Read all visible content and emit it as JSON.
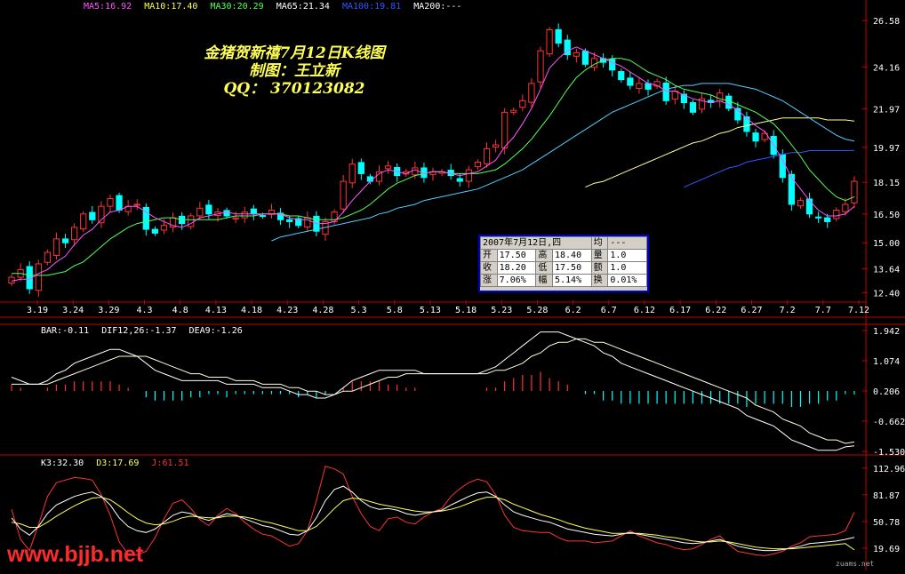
{
  "title_lines": [
    "金猪贺新禧7月12日K线图",
    "制图：王立新",
    "QQ： 370123082"
  ],
  "ma_legend": [
    {
      "label": "MA5:16.92",
      "color": "#ff55ff"
    },
    {
      "label": "MA10:17.40",
      "color": "#ffff55"
    },
    {
      "label": "MA30:20.29",
      "color": "#55ff55"
    },
    {
      "label": "MA65:21.34",
      "color": "#ffffff"
    },
    {
      "label": "MA100:19.81",
      "color": "#3355ff"
    },
    {
      "label": "MA200:---",
      "color": "#ffffff"
    }
  ],
  "macd_legend": [
    {
      "label": "BAR:-0.11",
      "color": "#ffffff"
    },
    {
      "label": "DIF12,26:-1.37",
      "color": "#ffffff"
    },
    {
      "label": "DEA9:-1.26",
      "color": "#ffffff"
    }
  ],
  "kdj_legend": [
    {
      "label": "K3:32.30",
      "color": "#ffffff"
    },
    {
      "label": "D3:17.69",
      "color": "#ffff55"
    },
    {
      "label": "J:61.51",
      "color": "#ff3333"
    }
  ],
  "info_box": {
    "header": [
      "2007年7月12日,四",
      "均",
      "---"
    ],
    "rows": [
      [
        "开",
        "17.50",
        "高",
        "18.40",
        "量",
        "1.0"
      ],
      [
        "收",
        "18.20",
        "低",
        "17.50",
        "额",
        "1.0"
      ],
      [
        "涨",
        "7.06%",
        "幅",
        "5.14%",
        "换",
        "0.01%"
      ]
    ]
  },
  "watermark": "www.bjjb.net",
  "corner_text": "zuams.net",
  "colors": {
    "up": "#ff3333",
    "down": "#00ffff",
    "axis": "#c00000",
    "bg": "#000000"
  },
  "chart_data": [
    {
      "type": "candlestick",
      "ylim": [
        12.0,
        27.0
      ],
      "y_ticks": [
        "26.58",
        "24.16",
        "21.97",
        "19.97",
        "18.15",
        "16.50",
        "15.00",
        "13.64",
        "12.40"
      ],
      "x_ticks": [
        "3.19",
        "3.24",
        "3.29",
        "4.3",
        "4.8",
        "4.13",
        "4.18",
        "4.23",
        "4.28",
        "5.3",
        "5.8",
        "5.13",
        "5.18",
        "5.23",
        "5.28",
        "6.2",
        "6.7",
        "6.12",
        "6.17",
        "6.22",
        "6.27",
        "7.2",
        "7.7",
        "7.12"
      ],
      "close": [
        13.2,
        13.6,
        12.6,
        13.9,
        14.5,
        15.2,
        15.0,
        15.8,
        16.5,
        16.2,
        16.9,
        17.3,
        16.7,
        16.9,
        17.0,
        15.7,
        15.5,
        15.9,
        16.3,
        16.0,
        16.4,
        16.8,
        16.5,
        16.6,
        16.4,
        16.3,
        16.6,
        16.5,
        16.4,
        16.7,
        16.2,
        16.1,
        15.9,
        16.3,
        15.6,
        16.1,
        16.6,
        18.2,
        19.1,
        18.6,
        18.2,
        18.7,
        19.0,
        18.5,
        18.7,
        18.9,
        18.4,
        18.7,
        18.7,
        18.5,
        18.2,
        18.8,
        19.2,
        19.9,
        20.1,
        21.8,
        21.9,
        22.4,
        23.3,
        25.0,
        26.1,
        25.4,
        24.8,
        24.9,
        24.3,
        24.6,
        24.4,
        24.0,
        23.5,
        23.2,
        23.3,
        23.0,
        23.4,
        22.4,
        22.9,
        22.3,
        21.8,
        22.5,
        22.3,
        22.8,
        22.0,
        21.4,
        20.8,
        20.3,
        20.7,
        19.6,
        18.4,
        17.0,
        17.2,
        16.5,
        16.3,
        16.1,
        16.7,
        17.0,
        18.2
      ],
      "ma5": [
        13.0,
        13.1,
        13.1,
        13.4,
        13.6,
        14.0,
        14.3,
        14.9,
        15.4,
        15.7,
        16.2,
        16.6,
        16.7,
        16.9,
        16.9,
        16.6,
        16.3,
        16.1,
        15.9,
        15.8,
        16.0,
        16.3,
        16.4,
        16.5,
        16.6,
        16.5,
        16.5,
        16.5,
        16.5,
        16.5,
        16.5,
        16.3,
        16.2,
        16.2,
        16.0,
        16.0,
        16.1,
        16.6,
        17.2,
        17.7,
        18.2,
        18.6,
        18.8,
        18.7,
        18.6,
        18.8,
        18.6,
        18.7,
        18.7,
        18.6,
        18.5,
        18.6,
        18.7,
        19.0,
        19.3,
        20.0,
        20.5,
        21.2,
        22.0,
        23.0,
        24.1,
        24.6,
        25.0,
        25.2,
        25.0,
        24.8,
        24.6,
        24.4,
        24.2,
        23.9,
        23.6,
        23.3,
        23.2,
        22.9,
        22.9,
        22.7,
        22.5,
        22.4,
        22.3,
        22.4,
        22.2,
        21.9,
        21.5,
        21.1,
        20.8,
        20.1,
        19.3,
        18.4,
        17.8,
        17.2,
        16.7,
        16.4,
        16.4,
        16.5,
        16.9
      ],
      "ma10": [
        13.4,
        13.4,
        13.3,
        13.3,
        13.3,
        13.4,
        13.5,
        13.8,
        14.0,
        14.4,
        14.8,
        15.2,
        15.5,
        15.8,
        16.0,
        16.1,
        16.2,
        16.3,
        16.3,
        16.2,
        16.2,
        16.2,
        16.2,
        16.2,
        16.3,
        16.4,
        16.4,
        16.4,
        16.5,
        16.5,
        16.5,
        16.4,
        16.4,
        16.3,
        16.2,
        16.2,
        16.2,
        16.3,
        16.5,
        16.7,
        17.0,
        17.4,
        17.8,
        18.1,
        18.3,
        18.5,
        18.6,
        18.7,
        18.7,
        18.6,
        18.6,
        18.6,
        18.6,
        18.7,
        18.8,
        19.1,
        19.5,
        19.9,
        20.4,
        21.0,
        21.6,
        22.3,
        23.0,
        23.6,
        24.0,
        24.3,
        24.5,
        24.6,
        24.6,
        24.5,
        24.2,
        23.9,
        23.7,
        23.5,
        23.2,
        23.0,
        22.9,
        22.8,
        22.7,
        22.5,
        22.4,
        22.2,
        22.0,
        21.8,
        21.5,
        21.2,
        20.7,
        20.1,
        19.5,
        18.8,
        18.3,
        17.8,
        17.4,
        17.2,
        17.4
      ],
      "ma30": [
        null,
        null,
        null,
        null,
        null,
        null,
        null,
        null,
        null,
        null,
        null,
        null,
        null,
        null,
        null,
        null,
        null,
        null,
        null,
        null,
        null,
        null,
        null,
        null,
        null,
        null,
        null,
        null,
        null,
        15.1,
        15.3,
        15.4,
        15.5,
        15.6,
        15.7,
        15.8,
        15.9,
        16.0,
        16.1,
        16.2,
        16.3,
        16.5,
        16.6,
        16.8,
        16.9,
        17.0,
        17.2,
        17.3,
        17.4,
        17.5,
        17.6,
        17.7,
        17.8,
        18.0,
        18.2,
        18.4,
        18.6,
        18.8,
        19.1,
        19.4,
        19.7,
        20.0,
        20.3,
        20.6,
        20.9,
        21.2,
        21.5,
        21.8,
        22.0,
        22.2,
        22.4,
        22.6,
        22.8,
        23.0,
        23.1,
        23.2,
        23.2,
        23.3,
        23.3,
        23.3,
        23.3,
        23.2,
        23.1,
        23.0,
        22.8,
        22.6,
        22.4,
        22.1,
        21.8,
        21.5,
        21.2,
        20.9,
        20.6,
        20.4,
        20.3
      ],
      "ma65": [
        null,
        null,
        null,
        null,
        null,
        null,
        null,
        null,
        null,
        null,
        null,
        null,
        null,
        null,
        null,
        null,
        null,
        null,
        null,
        null,
        null,
        null,
        null,
        null,
        null,
        null,
        null,
        null,
        null,
        null,
        null,
        null,
        null,
        null,
        null,
        null,
        null,
        null,
        null,
        null,
        null,
        null,
        null,
        null,
        null,
        null,
        null,
        null,
        null,
        null,
        null,
        null,
        null,
        null,
        null,
        null,
        null,
        null,
        null,
        null,
        null,
        null,
        null,
        null,
        17.9,
        18.1,
        18.2,
        18.4,
        18.6,
        18.8,
        19.0,
        19.2,
        19.4,
        19.6,
        19.8,
        20.0,
        20.2,
        20.3,
        20.5,
        20.7,
        20.8,
        21.0,
        21.1,
        21.2,
        21.3,
        21.4,
        21.5,
        21.5,
        21.5,
        21.5,
        21.5,
        21.4,
        21.4,
        21.4,
        21.34
      ],
      "ma100": [
        null,
        null,
        null,
        null,
        null,
        null,
        null,
        null,
        null,
        null,
        null,
        null,
        null,
        null,
        null,
        null,
        null,
        null,
        null,
        null,
        null,
        null,
        null,
        null,
        null,
        null,
        null,
        null,
        null,
        null,
        null,
        null,
        null,
        null,
        null,
        null,
        null,
        null,
        null,
        null,
        null,
        null,
        null,
        null,
        null,
        null,
        null,
        null,
        null,
        null,
        null,
        null,
        null,
        null,
        null,
        null,
        null,
        null,
        null,
        null,
        null,
        null,
        null,
        null,
        null,
        null,
        null,
        null,
        null,
        null,
        null,
        null,
        null,
        null,
        null,
        17.9,
        18.1,
        18.3,
        18.5,
        18.7,
        18.9,
        19.0,
        19.2,
        19.3,
        19.4,
        19.5,
        19.6,
        19.7,
        19.7,
        19.8,
        19.8,
        19.8,
        19.8,
        19.8,
        19.81
      ]
    },
    {
      "type": "line",
      "panel": "MACD",
      "y_ticks": [
        "1.942",
        "1.074",
        "0.206",
        "-0.662",
        "-1.530"
      ],
      "ylim": [
        -1.53,
        1.94
      ],
      "dif": [
        0.6,
        0.5,
        0.4,
        0.4,
        0.5,
        0.7,
        0.8,
        1.0,
        1.1,
        1.2,
        1.3,
        1.4,
        1.4,
        1.3,
        1.2,
        1.0,
        0.8,
        0.7,
        0.6,
        0.5,
        0.5,
        0.5,
        0.5,
        0.5,
        0.4,
        0.4,
        0.4,
        0.4,
        0.3,
        0.3,
        0.3,
        0.2,
        0.1,
        0.1,
        0.0,
        0.0,
        0.1,
        0.3,
        0.5,
        0.6,
        0.7,
        0.8,
        0.8,
        0.8,
        0.8,
        0.8,
        0.7,
        0.7,
        0.7,
        0.7,
        0.7,
        0.7,
        0.7,
        0.8,
        0.9,
        1.1,
        1.3,
        1.5,
        1.7,
        1.9,
        1.9,
        1.9,
        1.8,
        1.7,
        1.6,
        1.5,
        1.3,
        1.2,
        1.0,
        0.9,
        0.8,
        0.7,
        0.6,
        0.5,
        0.4,
        0.3,
        0.2,
        0.1,
        0.0,
        -0.1,
        -0.2,
        -0.3,
        -0.5,
        -0.6,
        -0.7,
        -0.8,
        -1.0,
        -1.2,
        -1.3,
        -1.4,
        -1.5,
        -1.5,
        -1.5,
        -1.4,
        -1.37
      ],
      "dea": [
        0.4,
        0.4,
        0.4,
        0.4,
        0.4,
        0.5,
        0.6,
        0.7,
        0.8,
        0.9,
        1.0,
        1.1,
        1.2,
        1.2,
        1.2,
        1.2,
        1.1,
        1.0,
        0.9,
        0.8,
        0.7,
        0.7,
        0.6,
        0.6,
        0.6,
        0.5,
        0.5,
        0.5,
        0.4,
        0.4,
        0.4,
        0.3,
        0.3,
        0.2,
        0.2,
        0.1,
        0.1,
        0.2,
        0.2,
        0.3,
        0.4,
        0.5,
        0.6,
        0.6,
        0.7,
        0.7,
        0.7,
        0.7,
        0.7,
        0.7,
        0.7,
        0.7,
        0.7,
        0.7,
        0.8,
        0.8,
        0.9,
        1.0,
        1.2,
        1.3,
        1.5,
        1.6,
        1.6,
        1.7,
        1.7,
        1.6,
        1.6,
        1.5,
        1.4,
        1.3,
        1.2,
        1.1,
        1.0,
        0.9,
        0.8,
        0.7,
        0.6,
        0.5,
        0.4,
        0.3,
        0.2,
        0.1,
        0.0,
        -0.2,
        -0.3,
        -0.4,
        -0.6,
        -0.7,
        -0.8,
        -1.0,
        -1.1,
        -1.2,
        -1.2,
        -1.3,
        -1.26
      ]
    },
    {
      "type": "line",
      "panel": "KDJ",
      "y_ticks": [
        "112.96",
        "81.87",
        "50.78",
        "19.69"
      ],
      "ylim": [
        0,
        120
      ],
      "k": [
        55,
        42,
        35,
        45,
        60,
        70,
        75,
        80,
        83,
        85,
        80,
        70,
        55,
        45,
        40,
        38,
        42,
        50,
        58,
        62,
        60,
        55,
        52,
        56,
        60,
        58,
        54,
        50,
        46,
        44,
        40,
        36,
        35,
        40,
        55,
        75,
        88,
        92,
        85,
        75,
        68,
        65,
        66,
        64,
        60,
        58,
        60,
        62,
        64,
        70,
        75,
        80,
        84,
        85,
        80,
        70,
        62,
        58,
        55,
        52,
        50,
        46,
        42,
        40,
        38,
        36,
        35,
        34,
        36,
        38,
        36,
        34,
        32,
        30,
        28,
        26,
        25,
        26,
        28,
        30,
        26,
        22,
        20,
        18,
        17,
        17,
        18,
        20,
        22,
        25,
        26,
        27,
        28,
        30,
        32.3
      ],
      "d": [
        50,
        48,
        44,
        44,
        50,
        57,
        63,
        69,
        74,
        78,
        79,
        76,
        69,
        61,
        54,
        49,
        47,
        48,
        51,
        55,
        57,
        56,
        55,
        55,
        57,
        57,
        56,
        54,
        51,
        49,
        46,
        43,
        40,
        40,
        45,
        55,
        66,
        75,
        78,
        77,
        74,
        71,
        69,
        67,
        65,
        63,
        62,
        62,
        63,
        65,
        68,
        72,
        76,
        79,
        79,
        76,
        71,
        67,
        63,
        59,
        56,
        53,
        49,
        46,
        43,
        41,
        39,
        37,
        37,
        37,
        37,
        36,
        35,
        33,
        32,
        30,
        28,
        27,
        27,
        28,
        27,
        25,
        23,
        21,
        20,
        19,
        19,
        19,
        20,
        21,
        22,
        23,
        24,
        25,
        17.69
      ],
      "j": [
        65,
        30,
        17,
        47,
        80,
        96,
        99,
        102,
        101,
        99,
        82,
        58,
        27,
        13,
        12,
        16,
        32,
        54,
        72,
        76,
        66,
        53,
        46,
        58,
        66,
        60,
        50,
        42,
        36,
        34,
        28,
        22,
        25,
        40,
        75,
        115,
        112,
        106,
        80,
        60,
        45,
        40,
        54,
        56,
        50,
        48,
        56,
        62,
        66,
        80,
        89,
        96,
        100,
        97,
        82,
        58,
        44,
        40,
        39,
        38,
        38,
        32,
        28,
        28,
        28,
        26,
        27,
        28,
        34,
        40,
        34,
        30,
        26,
        24,
        20,
        18,
        19,
        24,
        30,
        34,
        24,
        16,
        14,
        12,
        11,
        13,
        16,
        22,
        26,
        33,
        34,
        35,
        36,
        40,
        61.51
      ]
    }
  ]
}
